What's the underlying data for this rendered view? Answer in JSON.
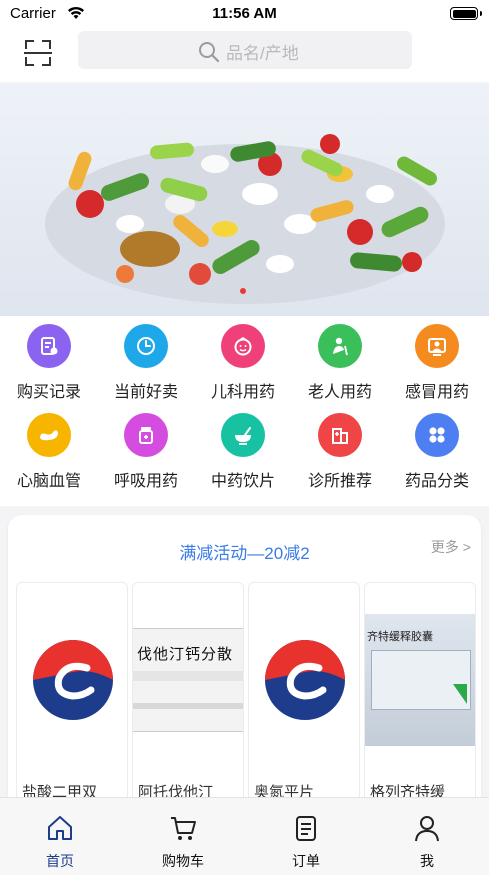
{
  "status_bar": {
    "carrier": "Carrier",
    "time": "11:56 AM"
  },
  "search": {
    "placeholder": "品名/产地"
  },
  "banner": {
    "image": "medicine-pills-photo",
    "active_dot_color": "#e53935"
  },
  "categories": [
    {
      "label": "购买记录",
      "icon": "purchase-record-icon",
      "color": "#8b63f0"
    },
    {
      "label": "当前好卖",
      "icon": "clock-icon",
      "color": "#1ea8ea"
    },
    {
      "label": "儿科用药",
      "icon": "child-face-icon",
      "color": "#f0407a"
    },
    {
      "label": "老人用药",
      "icon": "elder-person-icon",
      "color": "#3bbf5a"
    },
    {
      "label": "感冒用药",
      "icon": "cold-doctor-icon",
      "color": "#f58a1f"
    },
    {
      "label": "心脑血管",
      "icon": "heart-brain-icon",
      "color": "#f7b500"
    },
    {
      "label": "呼吸用药",
      "icon": "medicine-jar-icon",
      "color": "#d54de0"
    },
    {
      "label": "中药饮片",
      "icon": "herbal-bowl-icon",
      "color": "#17c2a3"
    },
    {
      "label": "诊所推荐",
      "icon": "clinic-building-icon",
      "color": "#f04547"
    },
    {
      "label": "药品分类",
      "icon": "grid-categories-icon",
      "color": "#4d7ff2"
    }
  ],
  "promo": {
    "title": "满减活动—20减2",
    "more": "更多 >",
    "products": [
      {
        "name": "盐酸二甲双",
        "image": "brand-logo"
      },
      {
        "name": "阿托伐他汀",
        "image": "box-atorvastatin",
        "box_text": "伐他汀钙分散"
      },
      {
        "name": "奥氮平片",
        "image": "brand-logo"
      },
      {
        "name": "格列齐特缓",
        "image": "box-gliclazide",
        "box_text": "齐特缓释胶囊"
      }
    ]
  },
  "tabbar": {
    "items": [
      {
        "label": "首页",
        "icon": "home-icon",
        "active": true
      },
      {
        "label": "购物车",
        "icon": "cart-icon",
        "active": false
      },
      {
        "label": "订单",
        "icon": "order-list-icon",
        "active": false
      },
      {
        "label": "我",
        "icon": "user-icon",
        "active": false
      }
    ]
  }
}
